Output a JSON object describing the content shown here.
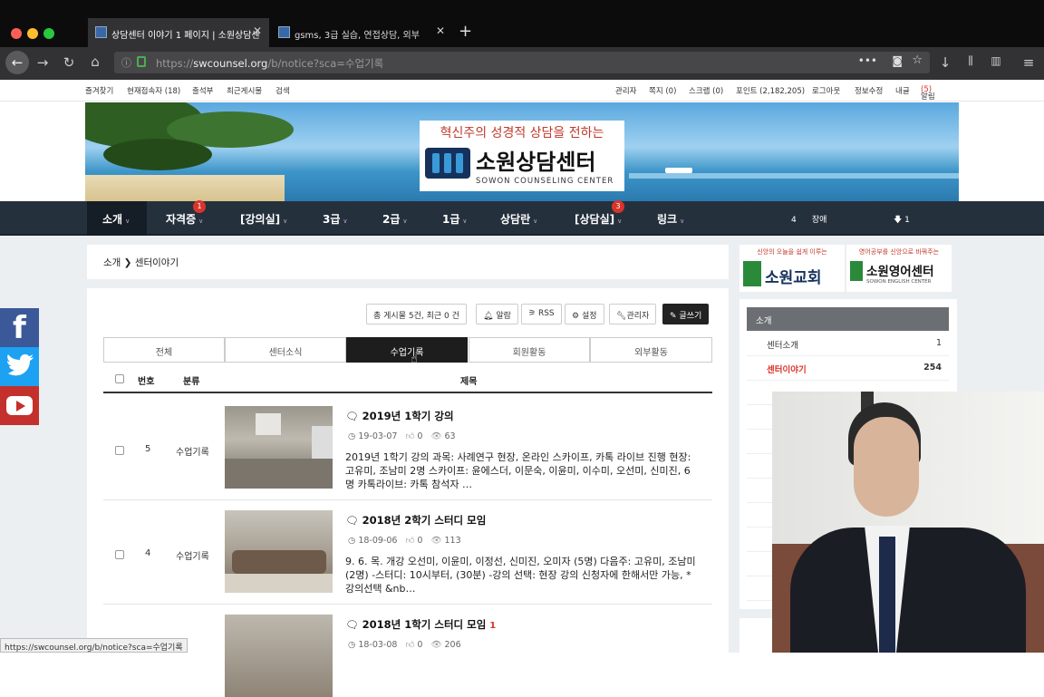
{
  "browser": {
    "tabs": [
      {
        "title": "상담센터 이야기 1 페이지 | 소원상담센"
      },
      {
        "title": "gsms, 3급 실습, 연접상담, 외부"
      }
    ],
    "url_prefix": "https://",
    "url_domain": "swcounsel.org",
    "url_path": "/b/notice?sca=수업기록",
    "status_url": "https://swcounsel.org/b/notice?sca=수업기록"
  },
  "toplinks": {
    "left": [
      "즐겨찾기",
      "현재접속자 (18)",
      "출석부",
      "최근게시물",
      "검색"
    ],
    "right": [
      "관리자",
      "쪽지 (0)",
      "스크랩 (0)",
      "포인트 (2,182,205)",
      "로그아웃",
      "정보수정",
      "내글",
      "알림"
    ],
    "notif_count": "(5)"
  },
  "banner": {
    "slogan": "혁신주의 성경적 상담을 전하는",
    "name": "소원상담센터",
    "name_en": "SOWON COUNSELING CENTER"
  },
  "menu": [
    {
      "label": "소개",
      "badge": ""
    },
    {
      "label": "자격증",
      "badge": "1"
    },
    {
      "label": "[강의실]",
      "badge": ""
    },
    {
      "label": "3급",
      "badge": ""
    },
    {
      "label": "2급",
      "badge": ""
    },
    {
      "label": "1급",
      "badge": ""
    },
    {
      "label": "상담란",
      "badge": ""
    },
    {
      "label": "[상담실]",
      "badge": "3"
    },
    {
      "label": "링크",
      "badge": ""
    }
  ],
  "menu_right": {
    "count": "4",
    "label": "장애",
    "down": "1"
  },
  "breadcrumb": {
    "parent": "소개",
    "current": "센터이야기"
  },
  "toolbar": {
    "summary": "총 게시물 5건, 최근 0 건",
    "alarm": "알람",
    "rss": "RSS",
    "settings": "설정",
    "admin": "관리자",
    "write": "글쓰기"
  },
  "categories": [
    "전체",
    "센터소식",
    "수업기록",
    "회원활동",
    "외부활동"
  ],
  "table": {
    "col_num": "번호",
    "col_cat": "분류",
    "col_title": "제목"
  },
  "posts": [
    {
      "num": "5",
      "cat": "수업기록",
      "title": "2019년 1학기 강의",
      "comments": "",
      "date": "19-03-07",
      "likes": "0",
      "views": "63",
      "excerpt": "2019년 1학기 강의   과목: 사례연구   현장, 온라인 스카이프, 카톡 라이브 진행 현장: 고유미, 조남미 2명 스카이프: 윤에스더, 이문숙, 이윤미, 이수미, 오선미, 신미진, 6명 카톡라이브: 카톡 참석자  …"
    },
    {
      "num": "4",
      "cat": "수업기록",
      "title": "2018년 2학기 스터디 모임",
      "comments": "",
      "date": "18-09-06",
      "likes": "0",
      "views": "113",
      "excerpt": "9. 6. 목. 개강 오선미, 이윤미, 이정선, 신미진, 오미자 (5명) 다음주: 고유미, 조남미 (2명) -스터디: 10시부터, (30분)   -강의 선택: 현장 강의 신청자에 한해서만 가능,   *강의선택 &nb…"
    },
    {
      "num": "",
      "cat": "",
      "title": "2018년 1학기 스터디 모임",
      "comments": "1",
      "date": "18-03-08",
      "likes": "0",
      "views": "206",
      "excerpt": ""
    }
  ],
  "sidebar": {
    "ad1_top": "신앙의 오늘을 쉽게 이루는",
    "ad1_name": "소원교회",
    "ad2_top": "영어공부를 신앙으로 바꿔주는",
    "ad2_name": "소원영어센터",
    "ad2_en": "SOWON ENGLISH CENTER",
    "heading": "소개",
    "items": [
      {
        "label": "센터소개",
        "count": "1"
      },
      {
        "label": "센터이야기",
        "count": "254"
      }
    ]
  },
  "colors": {
    "menu_bg": "#25303d",
    "accent_red": "#d9342b",
    "facebook": "#3b5998",
    "twitter": "#1da1f2",
    "youtube": "#c4302b"
  }
}
